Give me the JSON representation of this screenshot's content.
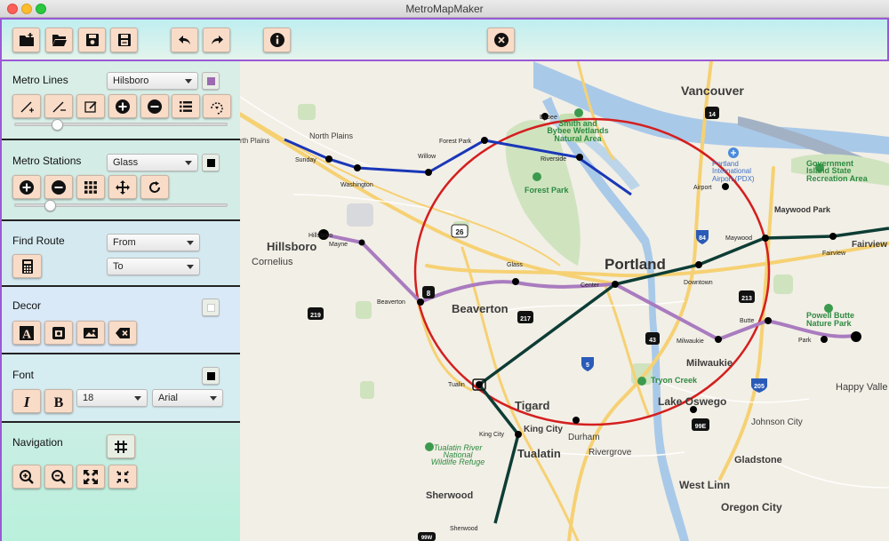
{
  "window": {
    "title": "MetroMapMaker"
  },
  "toolbar": {
    "buttons": [
      "new-file",
      "open-folder",
      "save",
      "save-as",
      "undo",
      "redo",
      "info",
      "exit"
    ]
  },
  "metro_lines": {
    "label": "Metro Lines",
    "selected_line": "Hilsboro",
    "line_color": "#9b6ab0"
  },
  "metro_stations": {
    "label": "Metro Stations",
    "selected_station": "Glass",
    "station_color": "#000000"
  },
  "find_route": {
    "label": "Find Route",
    "from_value": "From",
    "to_value": "To"
  },
  "decor": {
    "label": "Decor"
  },
  "font": {
    "label": "Font",
    "size_value": "18",
    "family_value": "Arial"
  },
  "navigation": {
    "label": "Navigation"
  },
  "map": {
    "cities": {
      "vancouver": "Vancouver",
      "portland": "Portland",
      "hillsboro": "Hillsboro",
      "cornelius": "Cornelius",
      "beaverton": "Beaverton",
      "tigard": "Tigard",
      "tualatin": "Tualatin",
      "sherwood": "Sherwood",
      "milwaukie": "Milwaukie",
      "lake_oswego": "Lake Oswego",
      "west_linn": "West Linn",
      "oregon_city": "Oregon City",
      "gladstone": "Gladstone",
      "johnson_city": "Johnson City",
      "happy_valley": "Happy Valle",
      "fairview": "Fairview",
      "king_city": "King City",
      "durham": "Durham",
      "rivergrove": "Rivergrove",
      "north_plains": "North Plains",
      "rth_plains": "rth Plains"
    },
    "places": {
      "smith_bybee": [
        "Smith and",
        "Bybee Wetlands",
        "Natural Area"
      ],
      "forest_park": "Forest Park",
      "pdx": [
        "Portland",
        "International",
        "Airport (PDX)"
      ],
      "govt_island": [
        "Government",
        "Island State",
        "Recreation Area"
      ],
      "powell_butte": [
        "Powell Butte",
        "Nature Park"
      ],
      "tryon_creek": "Tryon Creek",
      "tualatin_refuge": [
        "Tualatin River",
        "National",
        "Wildlife Refuge"
      ]
    },
    "stations": {
      "sunday": "Sunday",
      "washington": "Washington",
      "willow": "Willow",
      "forest_park": "Forest Park",
      "bybee": "Bybee",
      "riverside": "Riverside",
      "airport": "Airport",
      "maywood_park": "Maywood Park",
      "maywood": "Maywood",
      "fairview": "Fairview",
      "downtown": "Downtown",
      "center": "Center",
      "glass": "Glass",
      "hillsboro": "Hillsboro",
      "mayne": "Mayne",
      "beaverton": "Beaverton",
      "butte": "Butte",
      "milwaukie": "Milwaukie",
      "park": "Park",
      "tualin": "Tualin",
      "king_city": "King City",
      "sherwood": "Sherwood"
    },
    "shields": {
      "i84": "84",
      "i5": "5",
      "i205": "205",
      "us26": "26",
      "r8": "8",
      "r217": "217",
      "r219": "219",
      "r213": "213",
      "r43": "43",
      "r14": "14",
      "r99e": "99E",
      "r99w": "99W"
    }
  },
  "colors": {
    "blue_line": "#1a37b8",
    "red_circle": "#d41f1f",
    "purple_line": "#a97bbf",
    "green_line": "#0d3d35",
    "accent_border": "#9b59d6",
    "button_bg": "#f9dcc8"
  }
}
